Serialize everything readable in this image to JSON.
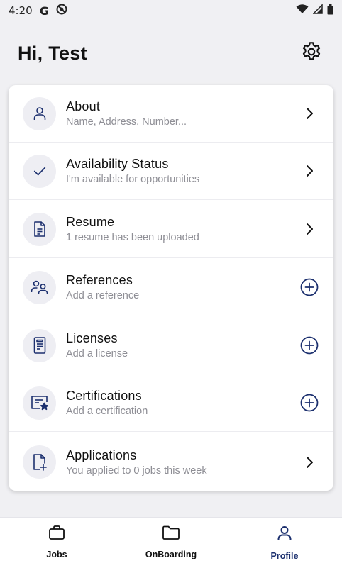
{
  "status_bar": {
    "time": "4:20",
    "g_label": "G"
  },
  "header": {
    "title": "Hi, Test",
    "settings_icon": "gear-icon"
  },
  "colors": {
    "accent": "#1b2f6e",
    "icon_bg": "#eeeef3",
    "subtext": "#8e8e95"
  },
  "items": [
    {
      "label": "About",
      "sub": "Name, Address, Number...",
      "icon": "person-icon",
      "action": "chevron-right-icon"
    },
    {
      "label": "Availability Status",
      "sub": "I'm available for opportunities",
      "icon": "check-icon",
      "action": "chevron-right-icon"
    },
    {
      "label": "Resume",
      "sub": "1 resume has been uploaded",
      "icon": "document-icon",
      "action": "chevron-right-icon"
    },
    {
      "label": "References",
      "sub": "Add a reference",
      "icon": "people-icon",
      "action": "plus-circle-icon"
    },
    {
      "label": "Licenses",
      "sub": "Add a license",
      "icon": "license-icon",
      "action": "plus-circle-icon"
    },
    {
      "label": "Certifications",
      "sub": "Add a certification",
      "icon": "certificate-icon",
      "action": "plus-circle-icon"
    },
    {
      "label": "Applications",
      "sub": "You applied to 0 jobs this week",
      "icon": "file-add-icon",
      "action": "chevron-right-icon"
    }
  ],
  "nav": [
    {
      "label": "Jobs",
      "icon": "briefcase-icon",
      "active": false
    },
    {
      "label": "OnBoarding",
      "icon": "folder-icon",
      "active": false
    },
    {
      "label": "Profile",
      "icon": "profile-icon",
      "active": true
    }
  ]
}
